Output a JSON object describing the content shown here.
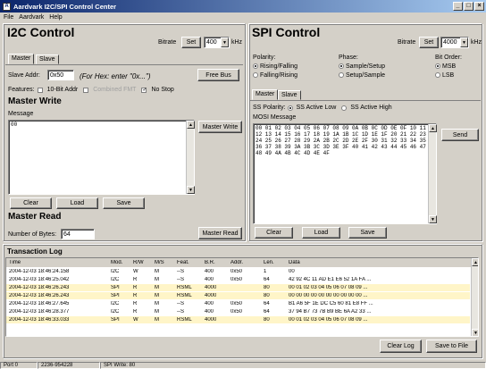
{
  "window": {
    "title": "Aardvark I2C/SPI Control Center",
    "minimize": "_",
    "maximize": "□",
    "close": "×"
  },
  "menu": [
    "File",
    "Aardvark",
    "Help"
  ],
  "i2c": {
    "title": "I2C Control",
    "bitrate_label": "Bitrate",
    "set_label": "Set",
    "bitrate_value": "400",
    "unit": "kHz",
    "tabs": [
      "Master",
      "Slave"
    ],
    "slave_addr_label": "Slave Addr:",
    "slave_addr_value": "0x50",
    "hex_hint": "(For Hex: enter \"0x...\")",
    "free_bus_label": "Free Bus",
    "features_label": "Features:",
    "feature_10bit": "10-Bit Addr",
    "feature_combined": "Combined FMT",
    "feature_nostop": "No Stop",
    "master_write_title": "Master Write",
    "message_label": "Message",
    "message_value": "00",
    "master_write_btn": "Master Write",
    "clear_label": "Clear",
    "load_label": "Load",
    "save_label": "Save",
    "master_read_title": "Master Read",
    "num_bytes_label": "Number of Bytes:",
    "num_bytes_value": "64",
    "master_read_btn": "Master Read"
  },
  "spi": {
    "title": "SPI Control",
    "bitrate_label": "Bitrate",
    "set_label": "Set",
    "bitrate_value": "4000",
    "unit": "kHz",
    "polarity_label": "Polarity:",
    "polarity_options": [
      "Rising/Falling",
      "Falling/Rising"
    ],
    "phase_label": "Phase:",
    "phase_options": [
      "Sample/Setup",
      "Setup/Sample"
    ],
    "bitorder_label": "Bit Order:",
    "bitorder_options": [
      "MSB",
      "LSB"
    ],
    "tabs": [
      "Master",
      "Slave"
    ],
    "ss_polarity_label": "SS Polarity:",
    "ss_options": [
      "SS Active Low",
      "SS Active High"
    ],
    "mosi_label": "MOSI Message",
    "mosi_lines": [
      "00 01 02 03 04 05 06 07 08 09 0A 0B 0C 0D 0E 0F 10 11",
      "12 13 14 15 16 17 18 19 1A 1B 1C 1D 1E 1F 20 21 22 23",
      "24 25 26 27 28 29 2A 2B 2C 2D 2E 2F 30 31 32 33 34 35",
      "36 37 38 39 3A 3B 3C 3D 3E 3F 40 41 42 43 44 45 46 47",
      "48 49 4A 4B 4C 4D 4E 4F"
    ],
    "send_label": "Send",
    "clear_label": "Clear",
    "load_label": "Load",
    "save_label": "Save"
  },
  "log": {
    "title": "Transaction Log",
    "columns": [
      "Time",
      "Mod.",
      "R/W",
      "M/S",
      "Feat.",
      "B.R.",
      "Addr.",
      "Len.",
      "Data"
    ],
    "rows": [
      [
        "2004-12-03 18:46:24.158",
        "I2C",
        "W",
        "M",
        "--S",
        "400",
        "0x50",
        "1",
        "00",
        "#ffffff"
      ],
      [
        "2004-12-03 18:46:25.042",
        "I2C",
        "R",
        "M",
        "--S",
        "400",
        "0x50",
        "64",
        "42 92 4C 11 AD E1 E6 52 1A FA ...",
        "#ffffff"
      ],
      [
        "2004-12-03 18:46:26.243",
        "SPI",
        "R",
        "M",
        "RSML",
        "4000",
        "",
        "80",
        "00 01 02 03 04 05 06 07 08 09 ...",
        "#fff5c8"
      ],
      [
        "2004-12-03 18:46:26.243",
        "SPI",
        "R",
        "M",
        "RSML",
        "4000",
        "",
        "80",
        "00 00 00 00 00 00 00 00 00 00 ...",
        "#fff5c8"
      ],
      [
        "2004-12-03 18:46:27.645",
        "I2C",
        "R",
        "M",
        "--S",
        "400",
        "0x50",
        "64",
        "B1 A6 5F 1E DC C5 60 81 E8 FF ...",
        "#ffffff"
      ],
      [
        "2004-12-03 18:46:28.377",
        "I2C",
        "R",
        "M",
        "--S",
        "400",
        "0x50",
        "64",
        "37 94 B7 73 7B B9 BE 6A A2 33 ...",
        "#ffffff"
      ],
      [
        "2004-12-03 18:46:33.033",
        "SPI",
        "W",
        "M",
        "RSML",
        "4000",
        "",
        "80",
        "00 01 02 03 04 05 06 07 08 09 ...",
        "#fff5c8"
      ]
    ],
    "clear_log_label": "Clear Log",
    "save_to_file_label": "Save to File"
  },
  "status": {
    "port": "Port 0",
    "device": "2236-954228",
    "last": "SPI Write: 80"
  },
  "colors": {
    "title_start": "#0a246a",
    "title_end": "#a6caf0",
    "spi_row": "#fff5c8"
  }
}
